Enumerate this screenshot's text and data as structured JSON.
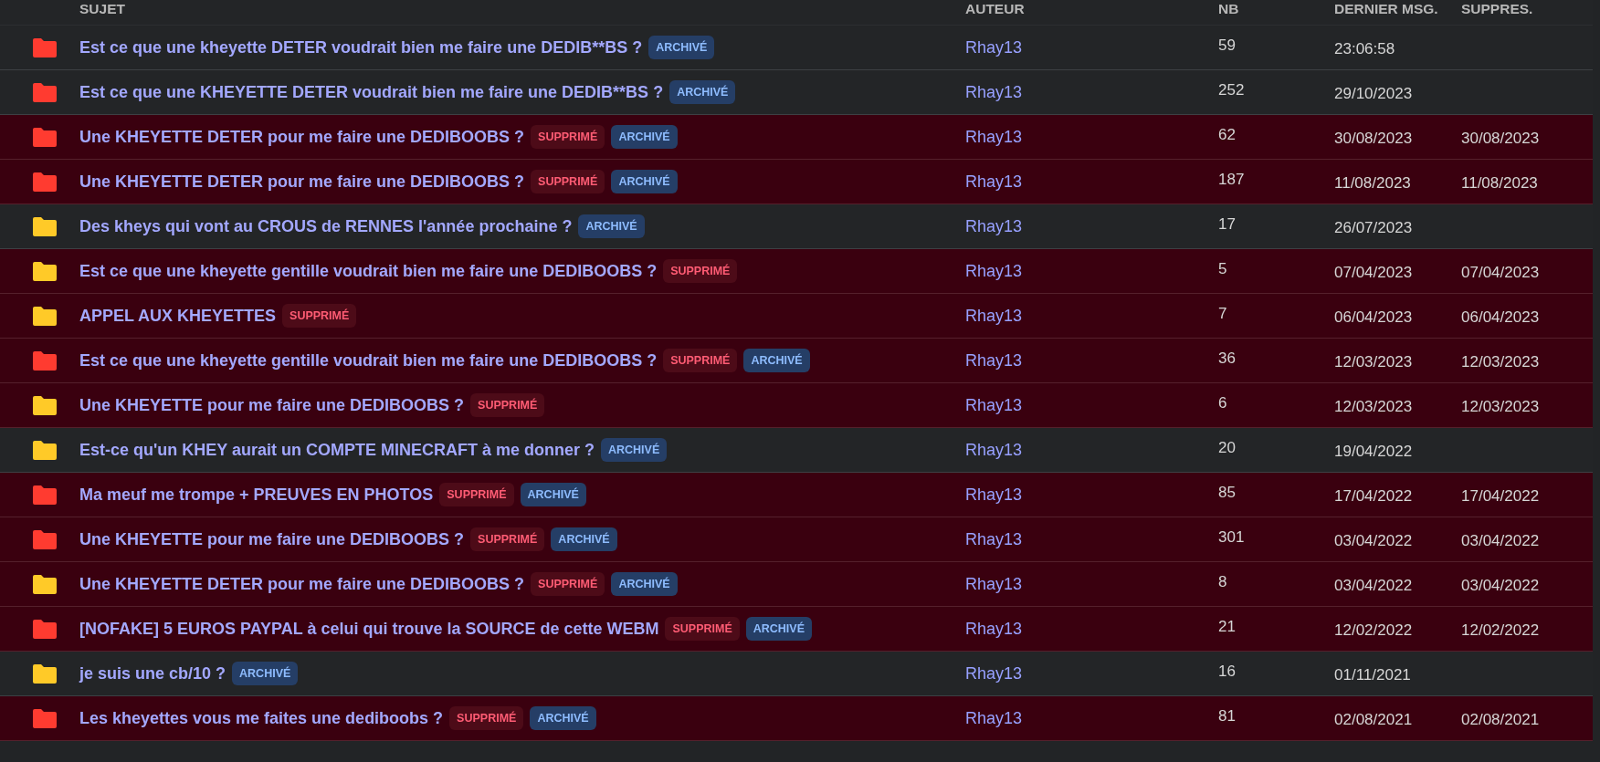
{
  "table": {
    "columns": [
      "SUJET",
      "AUTEUR",
      "NB",
      "DERNIER MSG.",
      "SUPPRES."
    ],
    "rows": [
      {
        "color": "#ff3b30",
        "title": "Est ce que une kheyette DETER voudrait bien me faire une DEDIB**BS ?",
        "deleted": false,
        "tags": [
          {
            "kind": "archived",
            "label": "ARCHIVÉ"
          }
        ],
        "author": "Rhay13",
        "count": "59",
        "last": "23:06:58"
      },
      {
        "color": "#ff3b30",
        "title": "Est ce que une KHEYETTE DETER voudrait bien me faire une DEDIB**BS ?",
        "deleted": false,
        "tags": [
          {
            "kind": "archived",
            "label": "ARCHIVÉ"
          }
        ],
        "author": "Rhay13",
        "count": "252",
        "last": "29/10/2023"
      },
      {
        "color": "#ff3b30",
        "title": "Une KHEYETTE DETER pour me faire une DEDIBOOBS ?",
        "deleted": true,
        "tags": [
          {
            "kind": "deleted",
            "label": "SUPPRIMÉ"
          },
          {
            "kind": "archived",
            "label": "ARCHIVÉ"
          }
        ],
        "author": "Rhay13",
        "count": "62",
        "last": "30/08/2023",
        "deleted_on": "30/08/2023"
      },
      {
        "color": "#ff3b30",
        "title": "Une KHEYETTE DETER pour me faire une DEDIBOOBS ?",
        "deleted": true,
        "tags": [
          {
            "kind": "deleted",
            "label": "SUPPRIMÉ"
          },
          {
            "kind": "archived",
            "label": "ARCHIVÉ"
          }
        ],
        "author": "Rhay13",
        "count": "187",
        "last": "11/08/2023",
        "deleted_on": "11/08/2023"
      },
      {
        "color": "#ffca28",
        "title": "Des kheys qui vont au CROUS de RENNES l'année prochaine ?",
        "deleted": false,
        "tags": [
          {
            "kind": "archived",
            "label": "ARCHIVÉ"
          }
        ],
        "author": "Rhay13",
        "count": "17",
        "last": "26/07/2023"
      },
      {
        "color": "#ffca28",
        "title": "Est ce que une kheyette gentille voudrait bien me faire une DEDIBOOBS ?",
        "deleted": true,
        "tags": [
          {
            "kind": "deleted",
            "label": "SUPPRIMÉ"
          }
        ],
        "author": "Rhay13",
        "count": "5",
        "last": "07/04/2023",
        "deleted_on": "07/04/2023"
      },
      {
        "color": "#ffca28",
        "title": "APPEL AUX KHEYETTES",
        "deleted": true,
        "tags": [
          {
            "kind": "deleted",
            "label": "SUPPRIMÉ"
          }
        ],
        "author": "Rhay13",
        "count": "7",
        "last": "06/04/2023",
        "deleted_on": "06/04/2023"
      },
      {
        "color": "#ff3b30",
        "title": "Est ce que une kheyette gentille voudrait bien me faire une DEDIBOOBS ?",
        "deleted": true,
        "tags": [
          {
            "kind": "deleted",
            "label": "SUPPRIMÉ"
          },
          {
            "kind": "archived",
            "label": "ARCHIVÉ"
          }
        ],
        "author": "Rhay13",
        "count": "36",
        "last": "12/03/2023",
        "deleted_on": "12/03/2023"
      },
      {
        "color": "#ffca28",
        "title": "Une KHEYETTE pour me faire une DEDIBOOBS ?",
        "deleted": true,
        "tags": [
          {
            "kind": "deleted",
            "label": "SUPPRIMÉ"
          }
        ],
        "author": "Rhay13",
        "count": "6",
        "last": "12/03/2023",
        "deleted_on": "12/03/2023"
      },
      {
        "color": "#ffca28",
        "title": "Est-ce qu'un KHEY aurait un COMPTE MINECRAFT à me donner ?",
        "deleted": false,
        "tags": [
          {
            "kind": "archived",
            "label": "ARCHIVÉ"
          }
        ],
        "author": "Rhay13",
        "count": "20",
        "last": "19/04/2022"
      },
      {
        "color": "#ff3b30",
        "title": "Ma meuf me trompe + PREUVES EN PHOTOS",
        "deleted": true,
        "tags": [
          {
            "kind": "deleted",
            "label": "SUPPRIMÉ"
          },
          {
            "kind": "archived",
            "label": "ARCHIVÉ"
          }
        ],
        "author": "Rhay13",
        "count": "85",
        "last": "17/04/2022",
        "deleted_on": "17/04/2022"
      },
      {
        "color": "#ff3b30",
        "title": "Une KHEYETTE pour me faire une DEDIBOOBS ?",
        "deleted": true,
        "tags": [
          {
            "kind": "deleted",
            "label": "SUPPRIMÉ"
          },
          {
            "kind": "archived",
            "label": "ARCHIVÉ"
          }
        ],
        "author": "Rhay13",
        "count": "301",
        "last": "03/04/2022",
        "deleted_on": "03/04/2022"
      },
      {
        "color": "#ffca28",
        "title": "Une KHEYETTE DETER pour me faire une DEDIBOOBS ?",
        "deleted": true,
        "tags": [
          {
            "kind": "deleted",
            "label": "SUPPRIMÉ"
          },
          {
            "kind": "archived",
            "label": "ARCHIVÉ"
          }
        ],
        "author": "Rhay13",
        "count": "8",
        "last": "03/04/2022",
        "deleted_on": "03/04/2022"
      },
      {
        "color": "#ff3b30",
        "title": "[NOFAKE] 5 EUROS PAYPAL à celui qui trouve la SOURCE de cette WEBM",
        "deleted": true,
        "tags": [
          {
            "kind": "deleted",
            "label": "SUPPRIMÉ"
          },
          {
            "kind": "archived",
            "label": "ARCHIVÉ"
          }
        ],
        "author": "Rhay13",
        "count": "21",
        "last": "12/02/2022",
        "deleted_on": "12/02/2022"
      },
      {
        "color": "#ffca28",
        "title": "je suis une cb/10 ?",
        "deleted": false,
        "tags": [
          {
            "kind": "archived",
            "label": "ARCHIVÉ"
          }
        ],
        "author": "Rhay13",
        "count": "16",
        "last": "01/11/2021"
      },
      {
        "color": "#ff3b30",
        "title": "Les kheyettes vous me faites une dediboobs ?",
        "deleted": true,
        "tags": [
          {
            "kind": "deleted",
            "label": "SUPPRIMÉ"
          },
          {
            "kind": "archived",
            "label": "ARCHIVÉ"
          }
        ],
        "author": "Rhay13",
        "count": "81",
        "last": "02/08/2021",
        "deleted_on": "02/08/2021"
      }
    ]
  }
}
